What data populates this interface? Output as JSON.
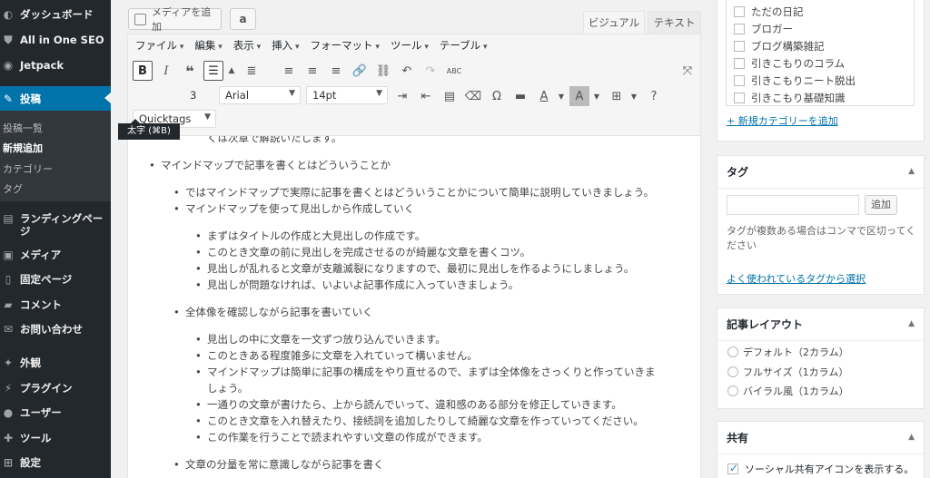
{
  "sidebar": {
    "items": [
      {
        "label": "ダッシュボード",
        "icon": "dashboard-icon",
        "glyph": "◐"
      },
      {
        "label": "All in One SEO",
        "icon": "seo-shield-icon",
        "glyph": "⛊"
      },
      {
        "label": "Jetpack",
        "icon": "jetpack-icon",
        "glyph": "◉"
      },
      {
        "label": "投稿",
        "icon": "pushpin-icon",
        "glyph": "✎"
      }
    ],
    "submenu": [
      "投稿一覧",
      "新規追加",
      "カテゴリー",
      "タグ"
    ],
    "items2": [
      {
        "label": "ランディングページ",
        "icon": "landing-page-icon",
        "glyph": "▤"
      },
      {
        "label": "メディア",
        "icon": "media-icon",
        "glyph": "▣"
      },
      {
        "label": "固定ページ",
        "icon": "page-icon",
        "glyph": "▯"
      },
      {
        "label": "コメント",
        "icon": "comment-icon",
        "glyph": "▰"
      },
      {
        "label": "お問い合わせ",
        "icon": "mail-icon",
        "glyph": "✉"
      },
      {
        "label": "外観",
        "icon": "appearance-icon",
        "glyph": "✦"
      },
      {
        "label": "プラグイン",
        "icon": "plugin-icon",
        "glyph": "⚡"
      },
      {
        "label": "ユーザー",
        "icon": "user-icon",
        "glyph": "●"
      },
      {
        "label": "ツール",
        "icon": "tools-icon",
        "glyph": "✚"
      },
      {
        "label": "設定",
        "icon": "settings-icon",
        "glyph": "⊞"
      }
    ]
  },
  "editor": {
    "media_button": "メディアを追加",
    "amazon_button": "a",
    "tab_visual": "ビジュアル",
    "tab_text": "テキスト",
    "menus": [
      "ファイル",
      "編集",
      "表示",
      "挿入",
      "フォーマット",
      "ツール",
      "テーブル"
    ],
    "tooltip": "太字 (⌘B)",
    "heading_select": "3",
    "font_select": "Arial",
    "size_select": "14pt",
    "quicktags": "Quicktags",
    "content": [
      "くは次章で解説いたします。",
      "マインドマップで記事を書くとはどういうことか",
      "ではマインドマップで実際に記事を書くとはどういうことかについて簡単に説明していきましょう。",
      "マインドマップを使って見出しから作成していく",
      "まずはタイトルの作成と大見出しの作成です。",
      "このとき文章の前に見出しを完成させるのが綺麗な文章を書くコツ。",
      "見出しが乱れると文章が支離滅裂になりますので、最初に見出しを作るようにしましょう。",
      "見出しが問題なければ、いよいよ記事作成に入っていきましょう。",
      "全体像を確認しながら記事を書いていく",
      "見出しの中に文章を一文ずつ放り込んでいきます。",
      "このときある程度雑多に文章を入れていって構いません。",
      "マインドマップは簡単に記事の構成をやり直せるので、まずは全体像をさっくりと作っていきま",
      "しょう。",
      "一通りの文章が書けたら、上から読んでいって、違和感のある部分を修正していきます。",
      "このとき文章を入れ替えたり、接続詞を追加したりして綺麗な文章を作っていってください。",
      "この作業を行うことで読まれやすい文章の作成ができます。",
      "文章の分量を常に意識しながら記事を書く"
    ]
  },
  "categories": {
    "items": [
      "ただの日記",
      "ブロガー",
      "ブログ構築雑記",
      "引きこもりのコラム",
      "引きこもりニート脱出",
      "引きこもり基礎知識"
    ],
    "add_link": "+ 新規カテゴリーを追加"
  },
  "tags": {
    "title": "タグ",
    "input_value": "",
    "add_button": "追加",
    "help": "タグが複数ある場合はコンマで区切ってください",
    "popular_link": "よく使われているタグから選択"
  },
  "layout_box": {
    "title": "記事レイアウト",
    "options": [
      "デフォルト（2カラム）",
      "フルサイズ（1カラム）",
      "バイラル風（1カラム）"
    ]
  },
  "share_box": {
    "title": "共有",
    "checkbox_label": "ソーシャル共有アイコンを表示する。",
    "checked": true
  },
  "colors": {
    "sidebar": "#23282d",
    "accent": "#0073aa"
  }
}
